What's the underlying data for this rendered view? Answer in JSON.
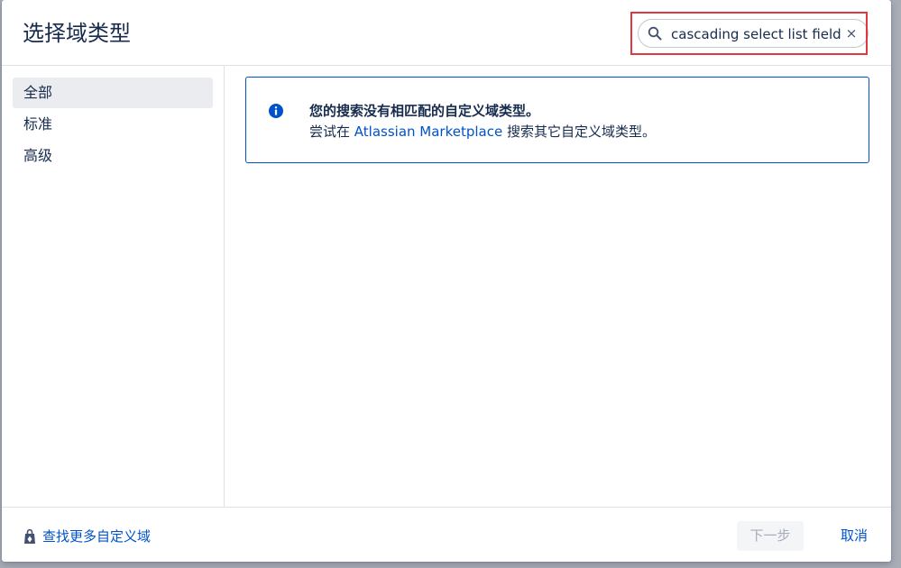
{
  "dialog": {
    "title": "选择域类型"
  },
  "search": {
    "value": "cascading select list field",
    "clear_icon": "×",
    "icon": "search-icon"
  },
  "sidebar": {
    "items": [
      {
        "label": "全部",
        "active": true
      },
      {
        "label": "标准",
        "active": false
      },
      {
        "label": "高级",
        "active": false
      }
    ]
  },
  "message": {
    "icon": "info-icon",
    "title": "您的搜索没有相匹配的自定义域类型。",
    "body_prefix": "尝试在 ",
    "link_text": "Atlassian Marketplace",
    "body_suffix": " 搜索其它自定义域类型。"
  },
  "footer": {
    "find_more_label": "查找更多自定义域",
    "find_more_icon": "shopping-bag-icon",
    "next_label": "下一步",
    "cancel_label": "取消"
  },
  "colors": {
    "accent": "#0052cc",
    "text": "#172b4d",
    "highlight_border": "#e0383e"
  }
}
